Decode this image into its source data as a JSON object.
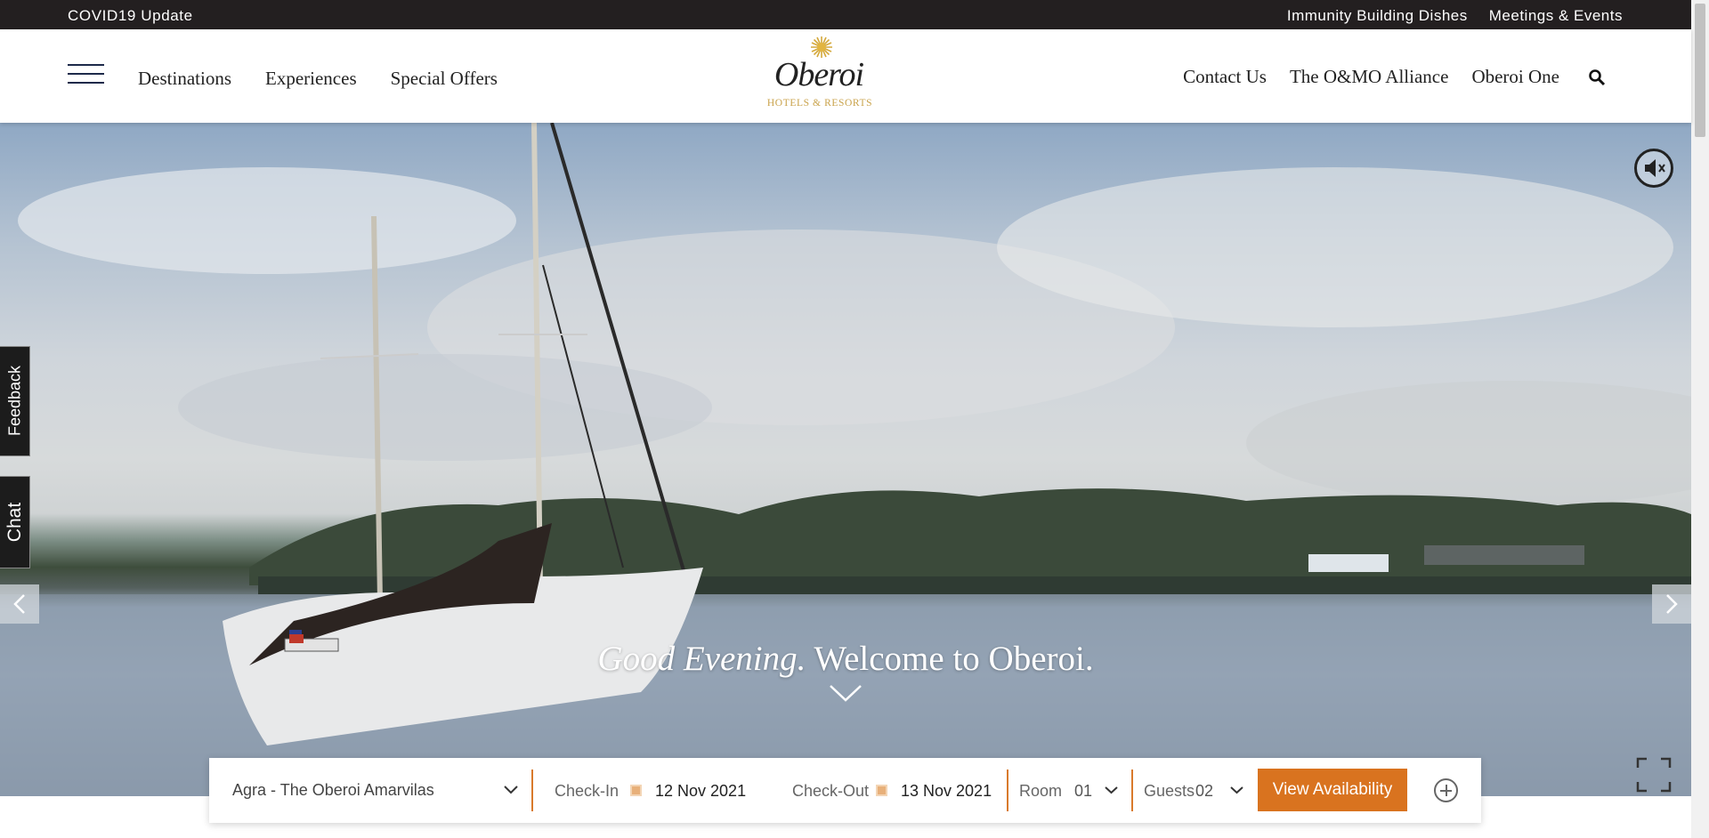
{
  "topbar": {
    "covid": "COVID19 Update",
    "links": [
      "Immunity Building Dishes",
      "Meetings & Events"
    ]
  },
  "header": {
    "nav_left": [
      "Destinations",
      "Experiences",
      "Special Offers"
    ],
    "logo_word": "Oberoi",
    "logo_sub": "HOTELS & RESORTS",
    "nav_right": [
      "Contact Us",
      "The O&MO Alliance",
      "Oberoi One"
    ],
    "search_icon": "search-icon"
  },
  "hero": {
    "greeting": "Good Evening.",
    "welcome": "Welcome to Oberoi."
  },
  "side_tabs": {
    "feedback": "Feedback",
    "chat": "Chat"
  },
  "booking": {
    "hotel": "Agra - The Oberoi Amarvilas",
    "checkin_label": "Check-In",
    "checkin_value": "12 Nov 2021",
    "checkout_label": "Check-Out",
    "checkout_value": "13 Nov 2021",
    "room_label": "Room",
    "room_value": "01",
    "guests_label": "Guests",
    "guests_value": "02",
    "cta": "View Availability"
  },
  "colors": {
    "accent": "#d9731f",
    "gold": "#c9a24a",
    "topbar": "#231f20"
  }
}
